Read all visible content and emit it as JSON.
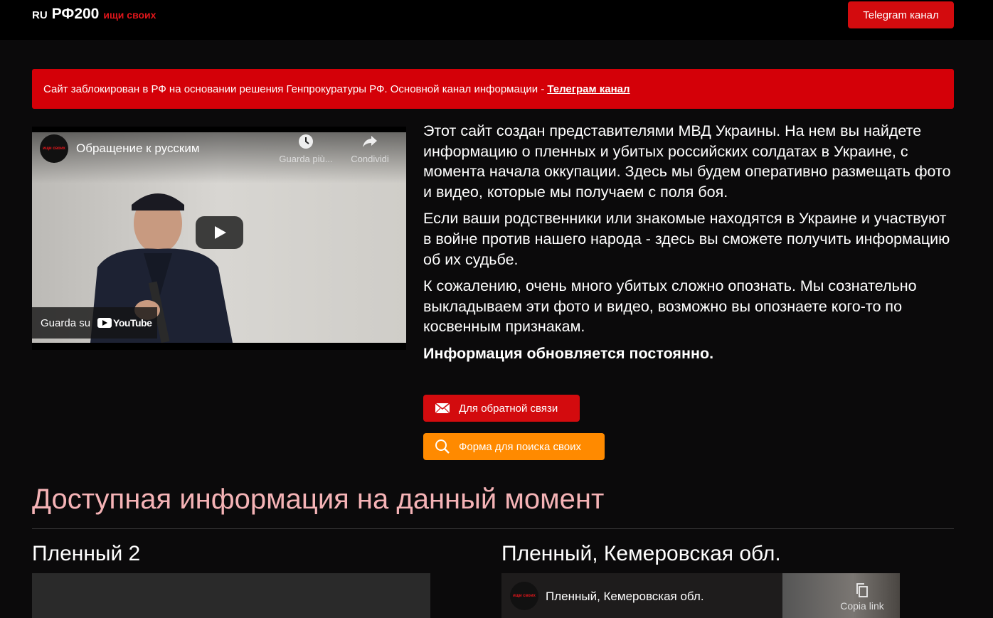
{
  "header": {
    "logo_ru": "RU",
    "logo_main": "РФ200",
    "logo_tagline": "ищи своих",
    "telegram_button": "Telegram канал"
  },
  "alert": {
    "text": "Сайт заблокирован в РФ на основании решения Генпрокуратуры РФ. Основной канал информации -",
    "link": "Телеграм канал"
  },
  "video": {
    "channel_avatar_text": "ищи своих",
    "title": "Обращение к русским",
    "watch_later": "Guarda più...",
    "share": "Condividi",
    "watch_on": "Guarda su",
    "youtube": "YouTube"
  },
  "intro": {
    "p1": "Этот сайт создан представителями МВД Украины. На нем вы найдете информацию о пленных и убитых российских солдатах в Украине, с момента начала оккупации. Здесь мы будем оперативно размещать фото и видео, которые мы получаем с поля боя.",
    "p2": "Если ваши родственники или знакомые находятся в Украине и участвуют в войне против нашего народа - здесь вы сможете получить информацию об их судьбе.",
    "p3": "К сожалению, очень много убитых сложно опознать. Мы сознательно выкладываем эти фото и видео, возможно вы опознаете кого-то по косвенным признакам.",
    "p4": "Информация обновляется постоянно."
  },
  "buttons": {
    "feedback": "Для обратной связи",
    "search_form": "Форма для поиска своих"
  },
  "colors": {
    "accent_red": "#d30b0e",
    "accent_orange": "#ff8a00",
    "section_title": "#f5b3b6",
    "background": "#0b0a0b"
  },
  "section": {
    "title": "Доступная информация на данный момент"
  },
  "cards": [
    {
      "title": "Пленный 2"
    },
    {
      "title": "Пленный, Кемеровская обл.",
      "video_title": "Пленный, Кемеровская обл.",
      "avatar_text": "ищи своих",
      "copy_link": "Copia link"
    }
  ]
}
